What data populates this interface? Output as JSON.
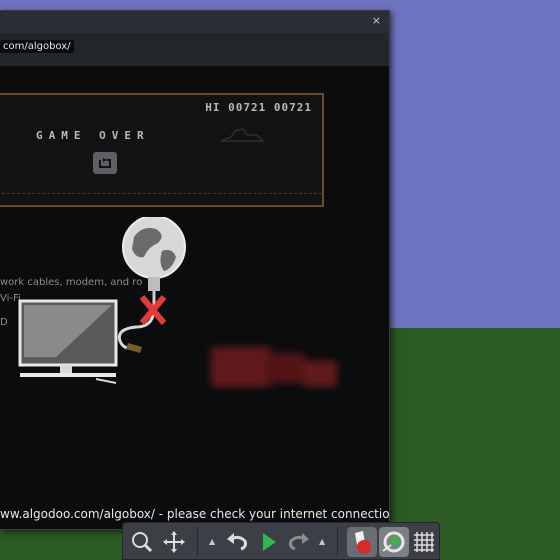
{
  "window": {
    "close_label": "×",
    "url": "com/algobox/"
  },
  "game": {
    "hi_score": "HI 00721 00721",
    "game_over": "GAME OVER"
  },
  "hints": {
    "line1": "work cables, modem, and ro",
    "line2": "Vi-Fi",
    "line3": "D"
  },
  "status": {
    "message": "ww.algodoo.com/algobox/ - please check your internet connection"
  },
  "colors": {
    "sky": "#6f74c0",
    "ground": "#2b5a22",
    "window_bg": "#0b0c0e",
    "game_border": "#6b4a2a",
    "error_red": "#e23a3a",
    "play_green": "#2fb84a"
  },
  "toolbar": {
    "buttons": [
      "zoom-icon",
      "move-icon",
      "undo-icon",
      "play-icon",
      "redo-icon",
      "sketch-tool-icon",
      "gear-tool-icon",
      "grid-icon"
    ]
  }
}
